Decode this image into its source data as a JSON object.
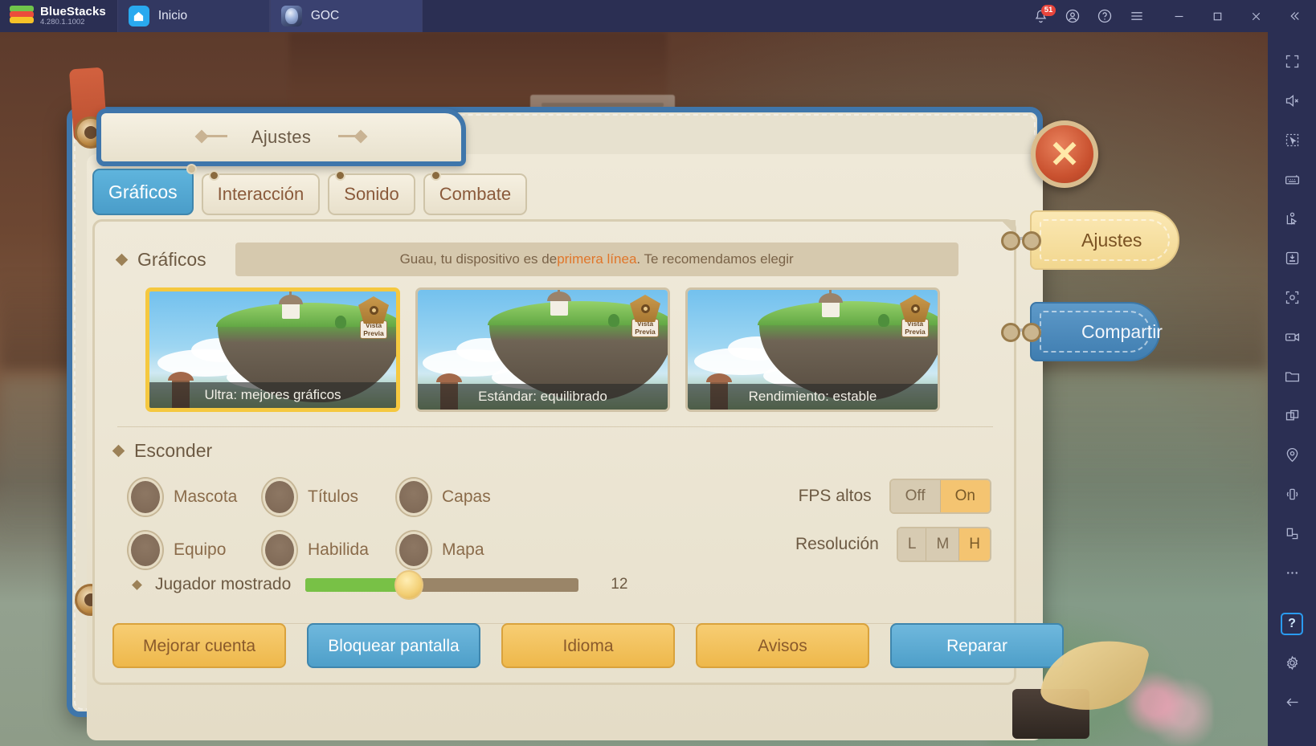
{
  "emulator": {
    "brand": "BlueStacks",
    "version": "4.280.1.1002",
    "tabs": [
      {
        "label": "Inicio",
        "icon": "home-icon",
        "active": false
      },
      {
        "label": "GOC",
        "icon": "game-app-icon",
        "active": true
      }
    ],
    "notification_count": "51",
    "titlebar_icons": [
      "bell-icon",
      "account-icon",
      "help-icon",
      "menu-icon",
      "minimize-icon",
      "maximize-icon",
      "close-icon",
      "collapse-icon"
    ],
    "rail_icons": [
      "fullscreen-icon",
      "mute-icon",
      "multi-select-icon",
      "keyboard-icon",
      "macro-icon",
      "apk-install-icon",
      "screenshot-icon",
      "record-icon",
      "folder-icon",
      "multi-instance-icon",
      "location-icon",
      "shake-icon",
      "rotate-icon",
      "more-icon",
      "help-icon",
      "settings-icon",
      "back-icon"
    ]
  },
  "window": {
    "title": "Ajustes",
    "close_label": "✕"
  },
  "tabs": [
    {
      "label": "Gráficos",
      "active": true
    },
    {
      "label": "Interacción",
      "active": false
    },
    {
      "label": "Sonido",
      "active": false
    },
    {
      "label": "Combate",
      "active": false
    }
  ],
  "graphics": {
    "section_title": "Gráficos",
    "recommendation_prefix": "Guau, tu dispositivo es de ",
    "recommendation_highlight": "primera línea",
    "recommendation_suffix": ". Te recomendamos elegir",
    "preview_badge_line1": "Vista",
    "preview_badge_line2": "Previa",
    "presets": [
      {
        "label": "Ultra: mejores gráficos",
        "selected": true
      },
      {
        "label": "Estándar: equilibrado",
        "selected": false
      },
      {
        "label": "Rendimiento: estable",
        "selected": false
      }
    ]
  },
  "hide": {
    "section_title": "Esconder",
    "options": [
      {
        "label": "Mascota",
        "checked": false
      },
      {
        "label": "Títulos",
        "checked": false
      },
      {
        "label": "Capas",
        "checked": false
      },
      {
        "label": "Equipo",
        "checked": false
      },
      {
        "label": "Habilida",
        "checked": false
      },
      {
        "label": "Mapa",
        "checked": false
      }
    ]
  },
  "settings_right": {
    "fps_label": "FPS altos",
    "fps_options": [
      "Off",
      "On"
    ],
    "fps_selected": "On",
    "resolution_label": "Resolución",
    "resolution_options": [
      "L",
      "M",
      "H"
    ],
    "resolution_selected": "H"
  },
  "slider": {
    "label": "Jugador mostrado",
    "value": "12",
    "percent": 38
  },
  "buttons": [
    {
      "label": "Mejorar cuenta",
      "style": "yellow"
    },
    {
      "label": "Bloquear pantalla",
      "style": "blue"
    },
    {
      "label": "Idioma",
      "style": "yellow"
    },
    {
      "label": "Avisos",
      "style": "yellow"
    },
    {
      "label": "Reparar",
      "style": "blue"
    }
  ],
  "side_tags": [
    {
      "label": "Ajustes",
      "style": "settings"
    },
    {
      "label": "Compartir",
      "style": "share"
    }
  ]
}
